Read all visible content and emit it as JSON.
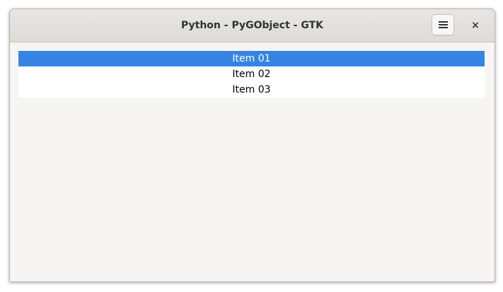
{
  "window": {
    "title": "Python - PyGObject - GTK"
  },
  "header": {
    "menu_icon": "hamburger-menu-icon",
    "close_label": "×"
  },
  "list": {
    "items": [
      {
        "label": "Item 01",
        "selected": true
      },
      {
        "label": "Item 02",
        "selected": false
      },
      {
        "label": "Item 03",
        "selected": false
      }
    ]
  },
  "colors": {
    "selection": "#3584e4",
    "window_bg": "#f6f5f4",
    "headerbar": "#e1dedb"
  }
}
